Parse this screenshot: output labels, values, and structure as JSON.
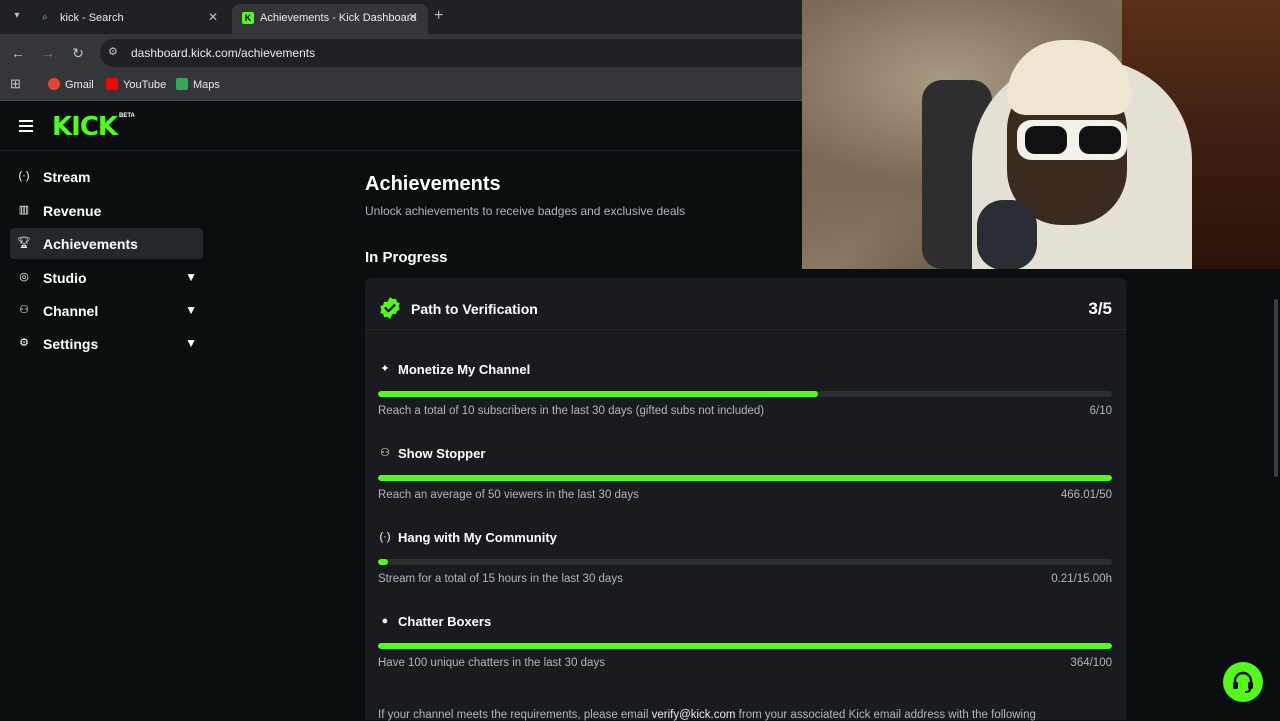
{
  "browser": {
    "tabs": [
      {
        "title": "kick - Search",
        "favicon": "search-icon",
        "active": false
      },
      {
        "title": "Achievements - Kick Dashboard",
        "favicon": "kick-icon",
        "active": true
      }
    ],
    "url": "dashboard.kick.com/achievements",
    "bookmarks": [
      {
        "label": "Gmail",
        "color": "#ea4335"
      },
      {
        "label": "YouTube",
        "color": "#ff0000"
      },
      {
        "label": "Maps",
        "color": "#34a853"
      }
    ]
  },
  "brand": {
    "logo": "KICK",
    "beta": "BETA",
    "accent": "#53fc18"
  },
  "sidebar": {
    "items": [
      {
        "label": "Stream",
        "icon": "broadcast-icon",
        "has_children": false,
        "active": false
      },
      {
        "label": "Revenue",
        "icon": "revenue-icon",
        "has_children": false,
        "active": false
      },
      {
        "label": "Achievements",
        "icon": "trophy-icon",
        "has_children": false,
        "active": true
      },
      {
        "label": "Studio",
        "icon": "studio-icon",
        "has_children": true,
        "active": false
      },
      {
        "label": "Channel",
        "icon": "channel-icon",
        "has_children": true,
        "active": false
      },
      {
        "label": "Settings",
        "icon": "gear-icon",
        "has_children": true,
        "active": false
      }
    ]
  },
  "page": {
    "title": "Achievements",
    "subtitle": "Unlock achievements to receive badges and exclusive deals",
    "section": "In Progress"
  },
  "card": {
    "title": "Path to Verification",
    "count": "3/5",
    "achievements": [
      {
        "name": "Monetize My Channel",
        "icon": "sparkle-icon",
        "desc": "Reach a total of 10 subscribers in the last 30 days (gifted subs not included)",
        "value": "6/10",
        "progress": 0.6
      },
      {
        "name": "Show Stopper",
        "icon": "users-icon",
        "desc": "Reach an average of 50 viewers in the last 30 days",
        "value": "466.01/50",
        "progress": 1.0
      },
      {
        "name": "Hang with My Community",
        "icon": "broadcast-icon",
        "desc": "Stream for a total of 15 hours in the last 30 days",
        "value": "0.21/15.00h",
        "progress": 0.014
      },
      {
        "name": "Chatter Boxers",
        "icon": "chat-icon",
        "desc": "Have 100 unique chatters in the last 30 days",
        "value": "364/100",
        "progress": 1.0
      }
    ],
    "footnote_prefix": "If your channel meets the requirements, please email ",
    "footnote_email": "verify@kick.com",
    "footnote_suffix": " from your associated Kick email address with the following"
  }
}
